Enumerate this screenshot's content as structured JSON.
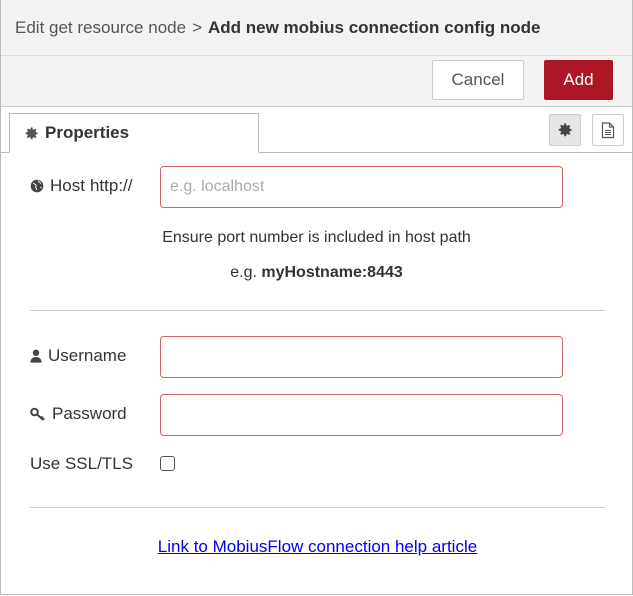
{
  "header": {
    "breadcrumb_parent": "Edit get resource node",
    "separator": ">",
    "title": "Add new mobius connection config node"
  },
  "toolbar": {
    "cancel_label": "Cancel",
    "add_label": "Add"
  },
  "tabs": {
    "properties_label": "Properties"
  },
  "form": {
    "host": {
      "label": "Host",
      "prefix": "http://",
      "value": "",
      "placeholder": "e.g. localhost"
    },
    "host_hint_line1": "Ensure port number is included in host path",
    "host_hint_eg": "e.g.",
    "host_hint_example": "myHostname:8443",
    "username": {
      "label": "Username",
      "value": ""
    },
    "password": {
      "label": "Password",
      "value": ""
    },
    "ssl": {
      "label": "Use SSL/TLS",
      "checked": false
    }
  },
  "help_link": "Link to MobiusFlow connection help article",
  "colors": {
    "accent": "#ad1625",
    "link": "#0000ee",
    "invalid_border": "#cc6666"
  }
}
